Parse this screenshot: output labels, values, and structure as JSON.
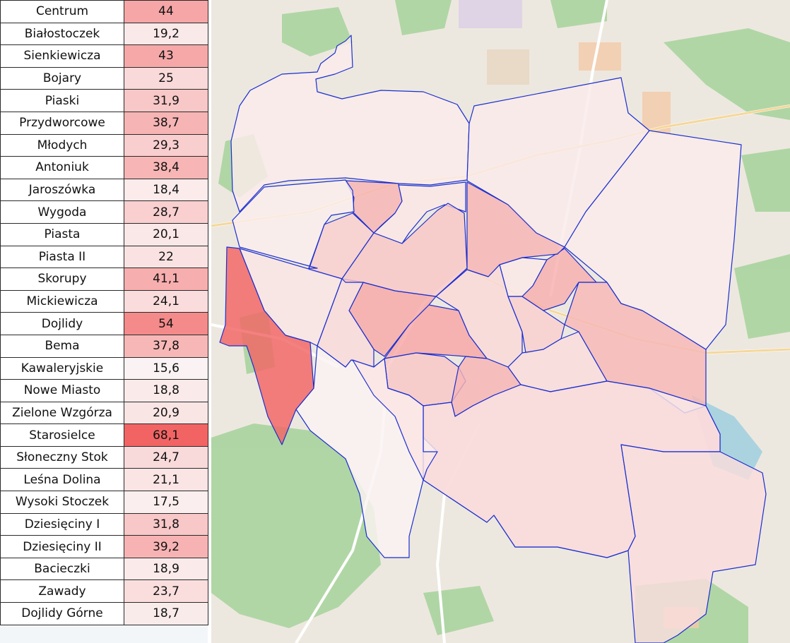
{
  "districts": [
    {
      "name": "Centrum",
      "value": "44"
    },
    {
      "name": "Białostoczek",
      "value": "19,2"
    },
    {
      "name": "Sienkiewicza",
      "value": "43"
    },
    {
      "name": "Bojary",
      "value": "25"
    },
    {
      "name": "Piaski",
      "value": "31,9"
    },
    {
      "name": "Przydworcowe",
      "value": "38,7"
    },
    {
      "name": "Młodych",
      "value": "29,3"
    },
    {
      "name": "Antoniuk",
      "value": "38,4"
    },
    {
      "name": "Jaroszówka",
      "value": "18,4"
    },
    {
      "name": "Wygoda",
      "value": "28,7"
    },
    {
      "name": "Piasta",
      "value": "20,1"
    },
    {
      "name": "Piasta II",
      "value": "22"
    },
    {
      "name": "Skorupy",
      "value": "41,1"
    },
    {
      "name": "Mickiewicza",
      "value": "24,1"
    },
    {
      "name": "Dojlidy",
      "value": "54"
    },
    {
      "name": "Bema",
      "value": "37,8"
    },
    {
      "name": "Kawaleryjskie",
      "value": "15,6"
    },
    {
      "name": "Nowe Miasto",
      "value": "18,8"
    },
    {
      "name": "Zielone Wzgórza",
      "value": "20,9"
    },
    {
      "name": "Starosielce",
      "value": "68,1"
    },
    {
      "name": "Słoneczny Stok",
      "value": "24,7"
    },
    {
      "name": "Leśna Dolina",
      "value": "21,1"
    },
    {
      "name": "Wysoki Stoczek",
      "value": "17,5"
    },
    {
      "name": "Dziesięciny I",
      "value": "31,8"
    },
    {
      "name": "Dziesięciny II",
      "value": "39,2"
    },
    {
      "name": "Bacieczki",
      "value": "18,9"
    },
    {
      "name": "Zawady",
      "value": "23,7"
    },
    {
      "name": "Dojlidy Górne",
      "value": "18,7"
    }
  ],
  "scale": {
    "min_value": 15.6,
    "max_value": 68.1,
    "low_color": "#fbf3f3",
    "high_color": "#f26464"
  },
  "map": {
    "boundary_color": "#1a2fd1",
    "base_color": "#efeae2",
    "forest_color": "#a8d5a0",
    "road_color": "#ffffff"
  }
}
